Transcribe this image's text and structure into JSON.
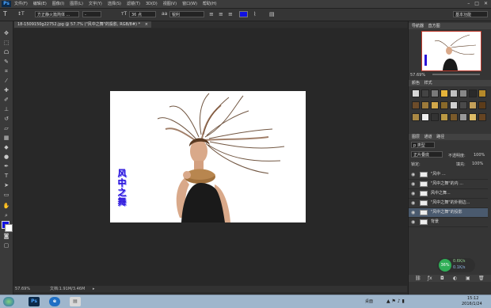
{
  "menubar": {
    "app_logo": "Ps",
    "menus": [
      "文件(F)",
      "编辑(E)",
      "图像(I)",
      "图层(L)",
      "文字(Y)",
      "选择(S)",
      "滤镜(T)",
      "3D(D)",
      "视图(V)",
      "窗口(W)",
      "帮助(H)"
    ],
    "window_controls": [
      "–",
      "□",
      "✕"
    ]
  },
  "optionsbar": {
    "font_family": "方正静火篇简体 ...",
    "font_style": "-",
    "font_size": "36 点",
    "antialias": "锐利",
    "text_color": "#1010e0",
    "workspace": "基本功能"
  },
  "document_tab": {
    "title": "18-1509150g22752.jpg @ 57.7% (\"风中之舞\"的投影, RGB/8#) *",
    "close": "×"
  },
  "canvas": {
    "text_art": "风中之舞",
    "text_art_color": "#2a10d8"
  },
  "statusbar": {
    "zoom": "57.69%",
    "doc_size": "文档:1.91M/3.46M"
  },
  "navigator": {
    "tabs": [
      "导航器",
      "直方图"
    ],
    "zoom": "57.69%"
  },
  "styles_panel": {
    "tabs": [
      "颜色",
      "样式"
    ]
  },
  "layers_panel": {
    "tabs": [
      "图层",
      "通道",
      "路径"
    ],
    "filter_label": "p 类型",
    "blend_mode": "正片叠底",
    "opacity_label": "不透明度:",
    "opacity_value": "100%",
    "lock_label": "锁定:",
    "fill_label": "填充:",
    "fill_value": "100%",
    "layers": [
      {
        "name": "\"风中 ...",
        "selected": false
      },
      {
        "name": "\"风中之舞\"的内 ...",
        "selected": false
      },
      {
        "name": "风中之舞...",
        "selected": false
      },
      {
        "name": "\"风中之舞\"的外侧边...",
        "selected": false
      },
      {
        "name": "\"风中之舞\"的投影",
        "selected": true
      },
      {
        "name": "背景",
        "selected": false
      }
    ]
  },
  "network_widget": {
    "percent": "36%",
    "upload": "0.6K/s",
    "download": "0.1K/s"
  },
  "taskbar": {
    "tray_label": "桌面",
    "time": "15:12",
    "date": "2016/1/24"
  }
}
